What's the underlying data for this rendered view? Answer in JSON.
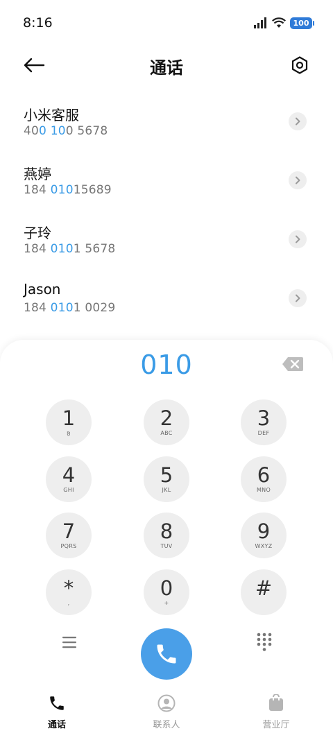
{
  "status_bar": {
    "time": "8:16",
    "battery": "100"
  },
  "header": {
    "title": "通话"
  },
  "results": [
    {
      "name": "小米客服",
      "number_parts": [
        {
          "t": "40",
          "h": false
        },
        {
          "t": "0",
          "h": true
        },
        {
          "t": " ",
          "h": false
        },
        {
          "t": "10",
          "h": true
        },
        {
          "t": "0 5678",
          "h": false
        }
      ]
    },
    {
      "name": "燕婷",
      "number_parts": [
        {
          "t": "184 ",
          "h": false
        },
        {
          "t": "010",
          "h": true
        },
        {
          "t": "15689",
          "h": false
        }
      ]
    },
    {
      "name": "子玲",
      "number_parts": [
        {
          "t": "184 ",
          "h": false
        },
        {
          "t": "010",
          "h": true
        },
        {
          "t": "1 5678",
          "h": false
        }
      ]
    },
    {
      "name": "Jason",
      "number_parts": [
        {
          "t": "184 ",
          "h": false
        },
        {
          "t": "010",
          "h": true
        },
        {
          "t": "1 0029",
          "h": false
        }
      ]
    }
  ],
  "dialpad": {
    "display": "010",
    "keys": [
      {
        "digit": "1",
        "letters": "ᱚ"
      },
      {
        "digit": "2",
        "letters": "ABC"
      },
      {
        "digit": "3",
        "letters": "DEF"
      },
      {
        "digit": "4",
        "letters": "GHI"
      },
      {
        "digit": "5",
        "letters": "JKL"
      },
      {
        "digit": "6",
        "letters": "MNO"
      },
      {
        "digit": "7",
        "letters": "PQRS"
      },
      {
        "digit": "8",
        "letters": "TUV"
      },
      {
        "digit": "9",
        "letters": "WXYZ"
      },
      {
        "digit": "*",
        "letters": ","
      },
      {
        "digit": "0",
        "letters": "+"
      },
      {
        "digit": "#",
        "letters": ""
      }
    ]
  },
  "bottom_nav": [
    {
      "label": "通话",
      "icon": "phone-icon",
      "active": true
    },
    {
      "label": "联系人",
      "icon": "contact-icon",
      "active": false
    },
    {
      "label": "营业厅",
      "icon": "shopping-bag-icon",
      "active": false
    }
  ],
  "colors": {
    "accent": "#3a9be6",
    "call_button": "#4a9fe8",
    "key_bg": "#eeeeee"
  }
}
